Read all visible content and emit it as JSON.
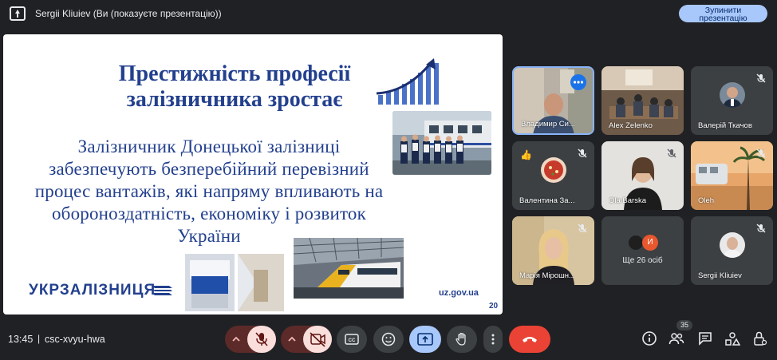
{
  "topbar": {
    "presenting_text": "Sergii Kliuiev (Ви (показуєте презентацію))",
    "stop_button_line1": "Зупинити",
    "stop_button_line2": "презентацію"
  },
  "slide": {
    "title_line1": "Престижність професії",
    "title_line2": "залізничника зростає",
    "body_lines": [
      "Залізничник Донецької залізниці",
      "забезпечують безперебійний перевізний",
      "процес вантажів, які напряму впливають на",
      "обороноздатність, економіку і розвиток",
      "України"
    ],
    "logo_text": "УКРЗАЛІЗНИЦЯ",
    "url": "uz.gov.ua",
    "page_number": "20",
    "brand_color": "#23408e"
  },
  "participants": [
    {
      "name": "Владимир Си...",
      "muted": false,
      "active_speaker": true,
      "has_menu": true
    },
    {
      "name": "Alex Zelenko",
      "muted": false
    },
    {
      "name": "Валерій Ткачов",
      "muted": true
    },
    {
      "name": "Валентина За...",
      "muted": true,
      "reaction": "thumbs-up"
    },
    {
      "name": "Ola Barska",
      "muted": true
    },
    {
      "name": "Oleh",
      "muted": true
    },
    {
      "name": "Марія Мірошн...",
      "muted": true
    },
    {
      "name": "Ще 26 осіб",
      "avatar_letter": "И"
    },
    {
      "name": "Sergii Kliuiev",
      "muted": true
    }
  ],
  "bottombar": {
    "time": "13:45",
    "separator": "|",
    "meeting_code": "csc-xvyu-hwa",
    "participant_count": "35",
    "accent_red": "#ea4335",
    "accent_blue": "#a8c7fa"
  }
}
